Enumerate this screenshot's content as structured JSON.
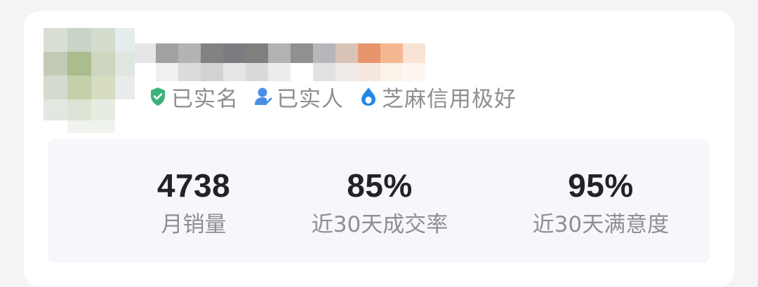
{
  "profile": {
    "badges": [
      {
        "label": "已实名",
        "icon": "shield-check-icon",
        "color": "#3bb27a"
      },
      {
        "label": "已实人",
        "icon": "person-check-icon",
        "color": "#4a90e2"
      },
      {
        "label": "芝麻信用极好",
        "icon": "sesame-credit-icon",
        "color": "#1e88e5"
      }
    ]
  },
  "stats": [
    {
      "value": "4738",
      "caption": "月销量"
    },
    {
      "value": "85%",
      "caption": "近30天成交率"
    },
    {
      "value": "95%",
      "caption": "近30天满意度"
    }
  ]
}
